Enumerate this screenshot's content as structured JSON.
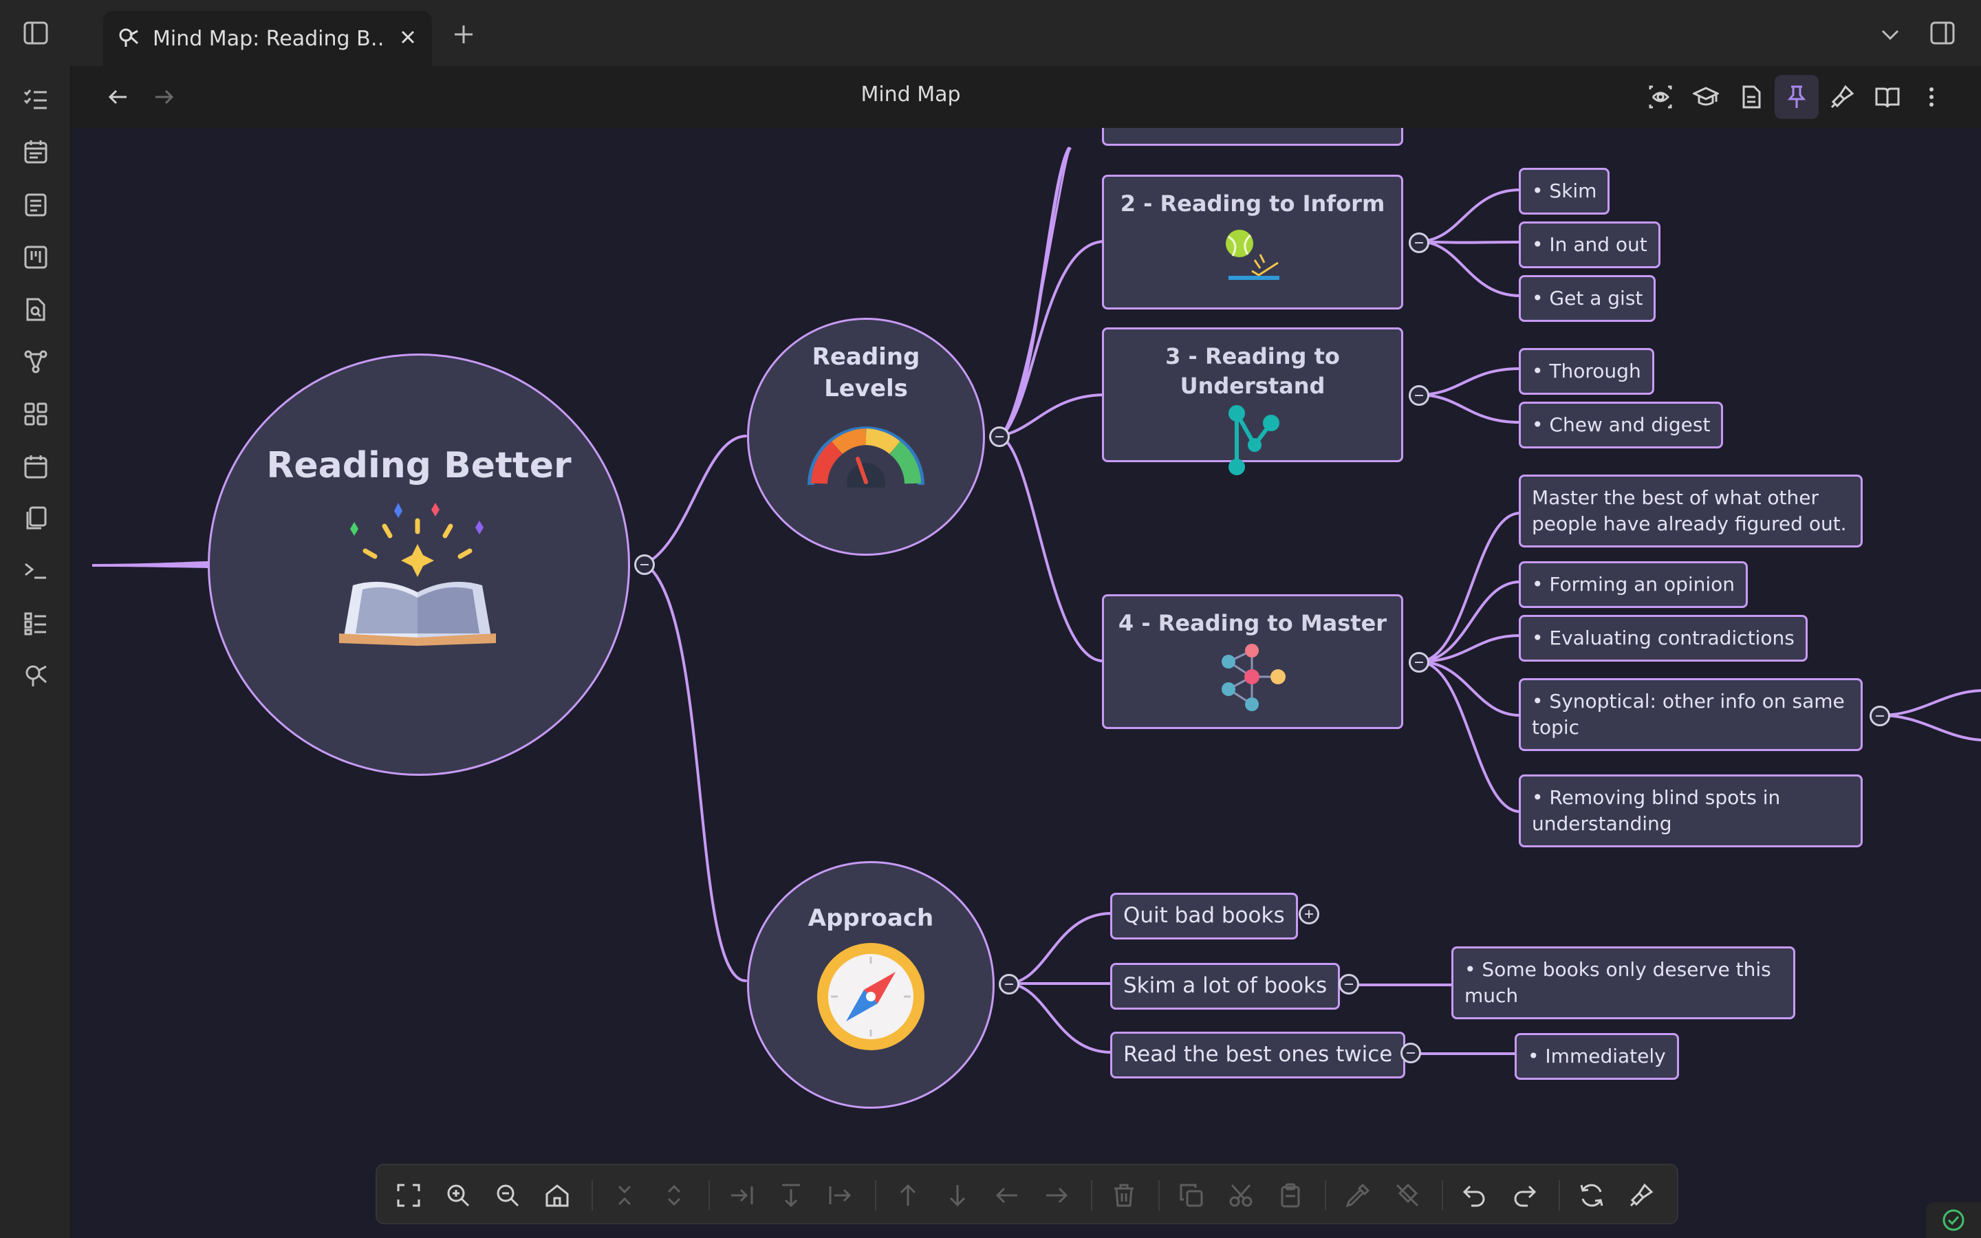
{
  "window": {
    "tab_title": "Mind Map: Reading B…",
    "view_title": "Mind Map"
  },
  "mindmap": {
    "root": {
      "title": "Reading Better"
    },
    "levels": {
      "title_line1": "Reading",
      "title_line2": "Levels",
      "items": [
        {
          "title": "2 - Reading to Inform",
          "children": [
            "• Skim",
            "• In and out",
            "• Get a gist"
          ]
        },
        {
          "title": "3 - Reading to Understand",
          "children": [
            "• Thorough",
            "• Chew and digest"
          ]
        },
        {
          "title": "4 - Reading to Master",
          "children": [
            "Master the best of what other people have already figured out.",
            "• Forming an opinion",
            "• Evaluating contradictions",
            "• Synoptical: other info on same topic",
            "• Removing blind spots in understanding"
          ]
        }
      ]
    },
    "approach": {
      "title": "Approach",
      "items": [
        {
          "title": "Quit bad books",
          "children": []
        },
        {
          "title": "Skim a lot of books",
          "children": [
            "• Some books only deserve this much"
          ]
        },
        {
          "title": "Read the best ones twice",
          "children": [
            "• Immediately"
          ]
        }
      ]
    }
  },
  "colors": {
    "edge": "#c79bf5",
    "node_bg": "#393a50",
    "canvas_bg": "#1d1c2b",
    "accent_active": "#a98af0"
  },
  "icons": {
    "tabbar": [
      "sidebar-toggle-icon",
      "mindmap-icon",
      "close-icon",
      "plus-icon",
      "chevron-down-icon",
      "right-sidebar-icon"
    ],
    "ribbon": [
      "checklist-icon",
      "calendar-icon",
      "note-icon",
      "kanban-icon",
      "file-search-icon",
      "graph-icon",
      "grid-icon",
      "calendar-icon",
      "copy-icon",
      "terminal-icon",
      "list-icon",
      "mindmap-icon"
    ],
    "nav": [
      "eye-icon",
      "graduation-icon",
      "document-icon",
      "pin-icon",
      "brush-icon",
      "book-icon",
      "more-icon"
    ],
    "toolbar": [
      "fullscreen-icon",
      "zoom-in-icon",
      "zoom-out-icon",
      "home-icon",
      "collapse-icon",
      "expand-icon",
      "indent-icon",
      "outdent-icon",
      "sibling-icon",
      "move-up-icon",
      "move-down-icon",
      "move-left-icon",
      "move-right-icon",
      "delete-icon",
      "duplicate-icon",
      "cut-icon",
      "paste-icon",
      "pipette-icon",
      "fill-icon",
      "undo-icon",
      "redo-icon",
      "refresh-icon",
      "format-brush-icon"
    ]
  }
}
